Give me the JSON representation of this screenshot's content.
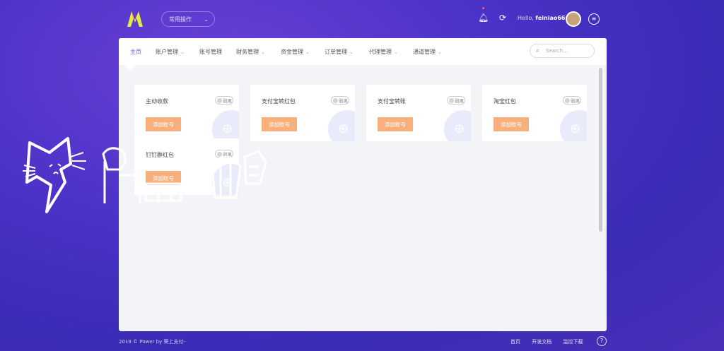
{
  "header": {
    "dropdown_label": "常用操作",
    "hello_prefix": "Hello,",
    "username": "feiniao666"
  },
  "nav": {
    "items": [
      {
        "label": "主页",
        "has_caret": false,
        "active": true
      },
      {
        "label": "账户管理",
        "has_caret": true
      },
      {
        "label": "账号管理",
        "has_caret": false
      },
      {
        "label": "财务管理",
        "has_caret": true
      },
      {
        "label": "资金管理",
        "has_caret": true
      },
      {
        "label": "订单管理",
        "has_caret": true
      },
      {
        "label": "代理管理",
        "has_caret": true
      },
      {
        "label": "通道管理",
        "has_caret": true
      }
    ],
    "search_placeholder": "Search..."
  },
  "cards": [
    {
      "title": "主动收款",
      "toggle": "弱离",
      "button": "添加账号"
    },
    {
      "title": "支付宝转红包",
      "toggle": "弱离",
      "button": "添加账号"
    },
    {
      "title": "支付宝转账",
      "toggle": "弱离",
      "button": "添加账号"
    },
    {
      "title": "淘宝红包",
      "toggle": "弱离",
      "button": "添加账号"
    },
    {
      "title": "钉钉群红包",
      "toggle": "弱离",
      "button": "添加账号"
    }
  ],
  "footer": {
    "copyright": "2019 © Power by 荣上支付-",
    "links": [
      "首页",
      "开发文档",
      "监控下载"
    ]
  },
  "colors": {
    "accent": "#6d5ef0",
    "button": "#f7b07c",
    "background": "#4b32c8"
  }
}
